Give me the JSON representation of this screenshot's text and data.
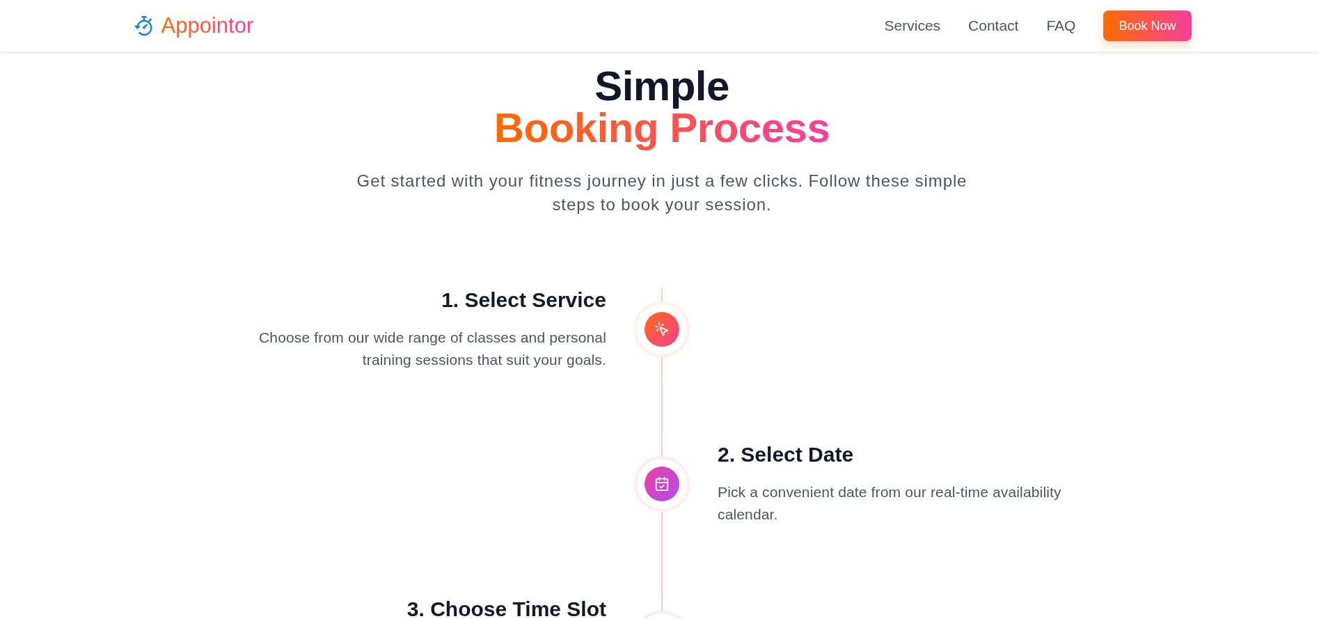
{
  "header": {
    "logo": "Appointor",
    "nav": [
      "Services",
      "Contact",
      "FAQ"
    ],
    "cta": "Book Now"
  },
  "hero": {
    "title": "Simple",
    "title_highlight": "Booking Process",
    "subtitle": "Get started with your fitness journey in just a few clicks. Follow these simple steps to book your session."
  },
  "steps": [
    {
      "title": "1. Select Service",
      "description": "Choose from our wide range of classes and personal training sessions that suit your goals."
    },
    {
      "title": "2. Select Date",
      "description": "Pick a convenient date from our real-time availability calendar."
    },
    {
      "title": "3. Choose Time Slot"
    }
  ]
}
